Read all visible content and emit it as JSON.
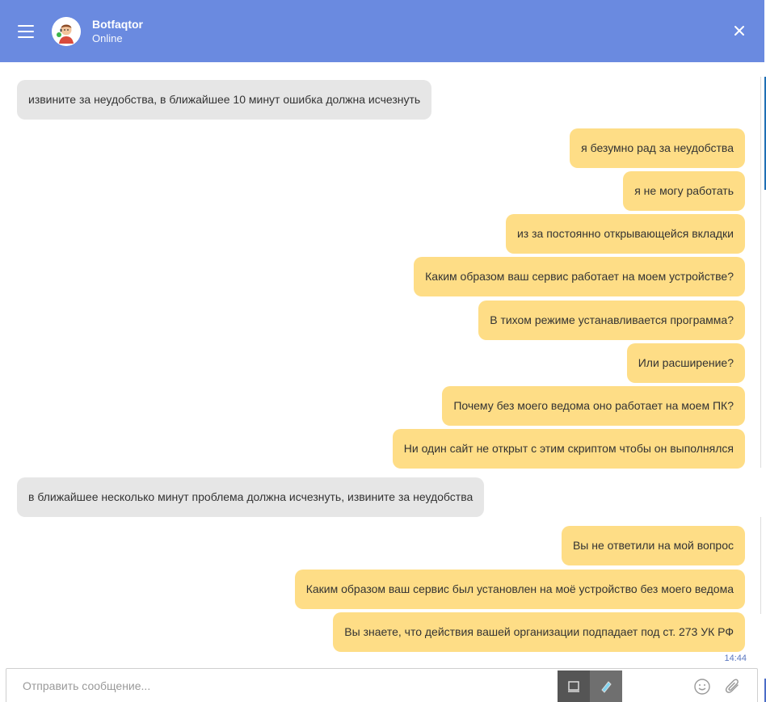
{
  "header": {
    "bot_name": "Botfaqtor",
    "status": "Online"
  },
  "composer": {
    "placeholder": "Отправить сообщение..."
  },
  "messages": [
    {
      "from": "bot",
      "text": "извините за неудобства, в ближайшее 10 минут ошибка должна исчезнуть"
    },
    {
      "from": "user",
      "text": "я безумно рад за неудобства"
    },
    {
      "from": "user",
      "text": "я не могу работать"
    },
    {
      "from": "user",
      "text": "из за постоянно открывающейся вкладки"
    },
    {
      "from": "user",
      "text": "Каким образом ваш сервис работает на моем устройстве?"
    },
    {
      "from": "user",
      "text": "В тихом режиме устанавливается программа?"
    },
    {
      "from": "user",
      "text": "Или расширение?"
    },
    {
      "from": "user",
      "text": "Почему без моего ведома оно работает на моем ПК?"
    },
    {
      "from": "user",
      "text": "Ни один сайт не открыт с этим скриптом чтобы он выполнялся"
    },
    {
      "from": "bot",
      "text": "в ближайшее несколько минут проблема должна исчезнуть, извините за неудобства"
    },
    {
      "from": "user",
      "text": "Вы не ответили на мой вопрос"
    },
    {
      "from": "user",
      "text": "Каким образом ваш сервис был установлен на моё устройство без моего ведома"
    },
    {
      "from": "user",
      "text": "Вы знаете, что действия вашей организации подпадает под ст. 273 УК РФ"
    }
  ],
  "last_message_time": "14:44",
  "colors": {
    "header_bg": "#6a8ae0",
    "bot_bubble": "#e6e6e6",
    "user_bubble": "#fedd86"
  },
  "icons": {
    "menu": "hamburger-icon",
    "close": "close-icon",
    "emoji": "smiley-icon",
    "attach": "paperclip-icon"
  }
}
